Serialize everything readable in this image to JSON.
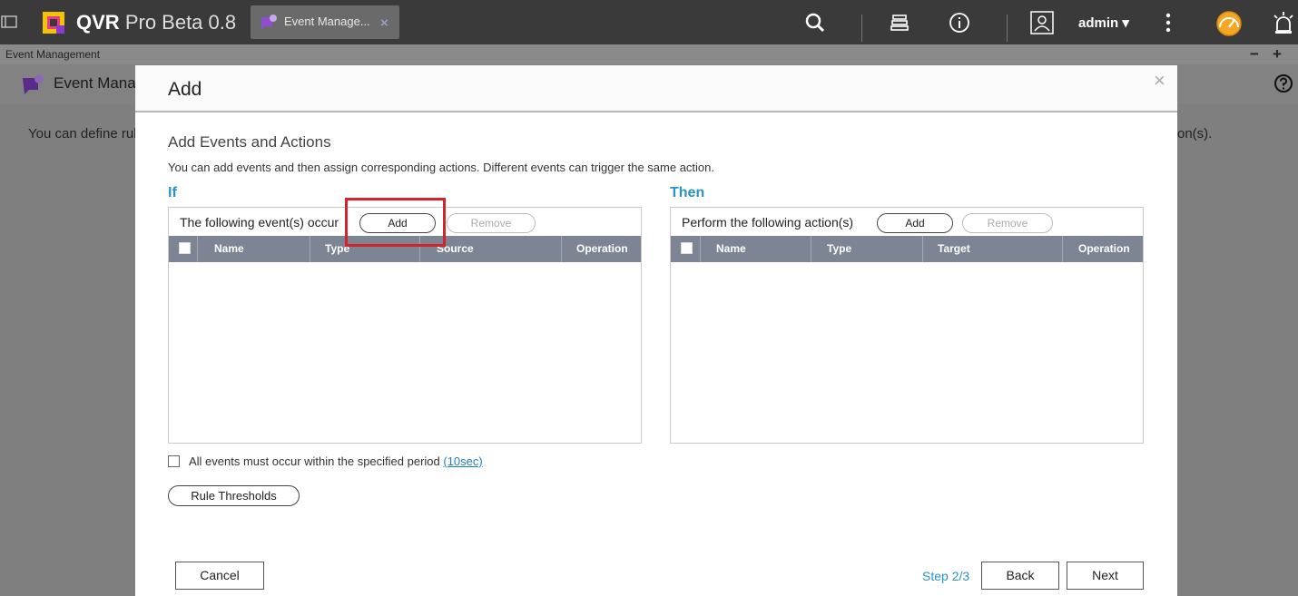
{
  "app": {
    "title_main": "QVR",
    "title_sub": "Pro Beta 0.8",
    "user": "admin ▾"
  },
  "tab": {
    "label": "Event Manage...",
    "close": "×"
  },
  "window": {
    "title": "Event Management",
    "minimize": "−",
    "maximize": "+"
  },
  "background": {
    "page_title": "Event Manag",
    "desc_left": "You can define rul",
    "desc_right": "on(s)."
  },
  "modal": {
    "title": "Add",
    "close": "×",
    "section_title": "Add Events and Actions",
    "section_desc": "You can add events and then assign corresponding actions. Different events can trigger the same action.",
    "if_label": "If",
    "then_label": "Then",
    "events": {
      "label": "The following event(s) occur",
      "add": "Add",
      "remove": "Remove",
      "columns": [
        "Name",
        "Type",
        "Source",
        "Operation"
      ]
    },
    "actions": {
      "label": "Perform the following action(s)",
      "add": "Add",
      "remove": "Remove",
      "columns": [
        "Name",
        "Type",
        "Target",
        "Operation"
      ]
    },
    "period": {
      "text": "All events must occur within the specified period ",
      "link": "(10sec)"
    },
    "rule_thresholds": "Rule Thresholds",
    "cancel": "Cancel",
    "step": "Step 2/3",
    "back": "Back",
    "next": "Next"
  },
  "colors": {
    "accent": "#2a93c7",
    "highlight": "#d3232c",
    "table_header": "#7d8595"
  }
}
